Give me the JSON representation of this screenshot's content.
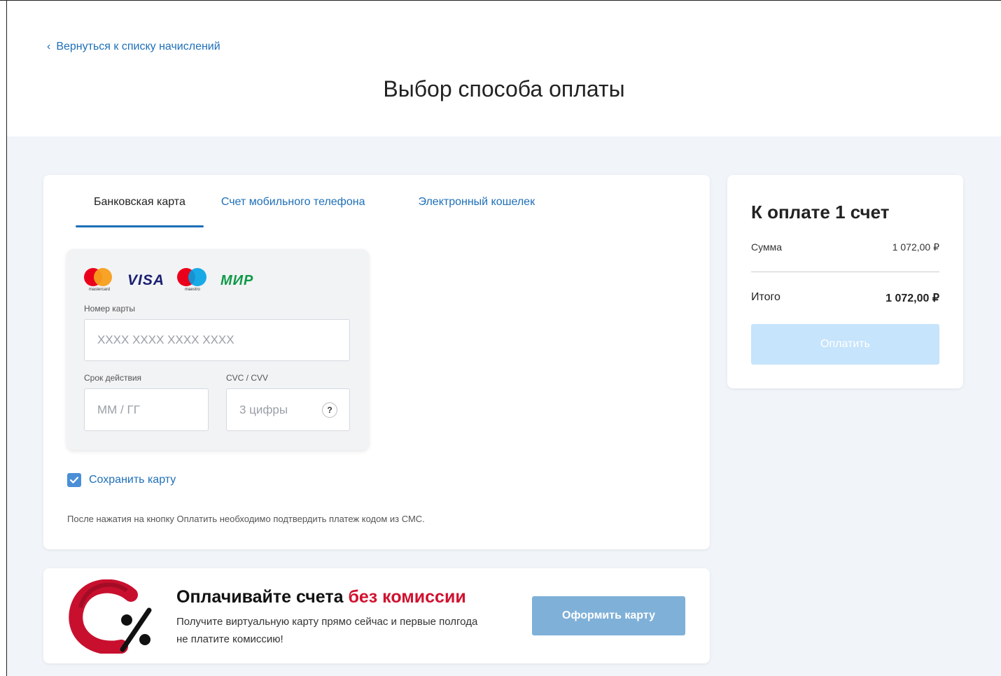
{
  "header": {
    "back_link": "Вернуться к списку начислений",
    "title": "Выбор способа оплаты"
  },
  "tabs": [
    {
      "label": "Банковская карта",
      "active": true
    },
    {
      "label": "Счет мобильного телефона",
      "active": false
    },
    {
      "label": "Электронный кошелек",
      "active": false
    }
  ],
  "card_form": {
    "brands": {
      "mastercard_caption": "mastercard",
      "visa": "VISA",
      "maestro_caption": "maestro",
      "mir": "МИР"
    },
    "number_label": "Номер карты",
    "number_placeholder": "XXXX XXXX XXXX XXXX",
    "expiry_label": "Срок действия",
    "expiry_placeholder": "ММ / ГГ",
    "cvc_label": "CVC / CVV",
    "cvc_placeholder": "3 цифры",
    "cvc_help": "?"
  },
  "save_card": {
    "label": "Сохранить карту",
    "checked": true
  },
  "note": "После нажатия на кнопку Оплатить необходимо подтвердить платеж кодом из СМС.",
  "summary": {
    "title": "К оплате 1 счет",
    "sum_label": "Сумма",
    "sum_value": "1 072,00 ₽",
    "total_label": "Итого",
    "total_value": "1 072,00 ₽",
    "pay_button": "Оплатить"
  },
  "promo": {
    "title_main": "Оплачивайте счета ",
    "title_accent": "без комиссии",
    "text": "Получите виртуальную карту прямо сейчас и первые полгода не платите комиссию!",
    "button": "Оформить карту"
  },
  "colors": {
    "accent": "#1e6fb8",
    "background": "#f1f5f9",
    "pay_button_disabled": "#c6e4fb",
    "promo_button": "#7fb0d8",
    "promo_accent": "#d1112f"
  }
}
